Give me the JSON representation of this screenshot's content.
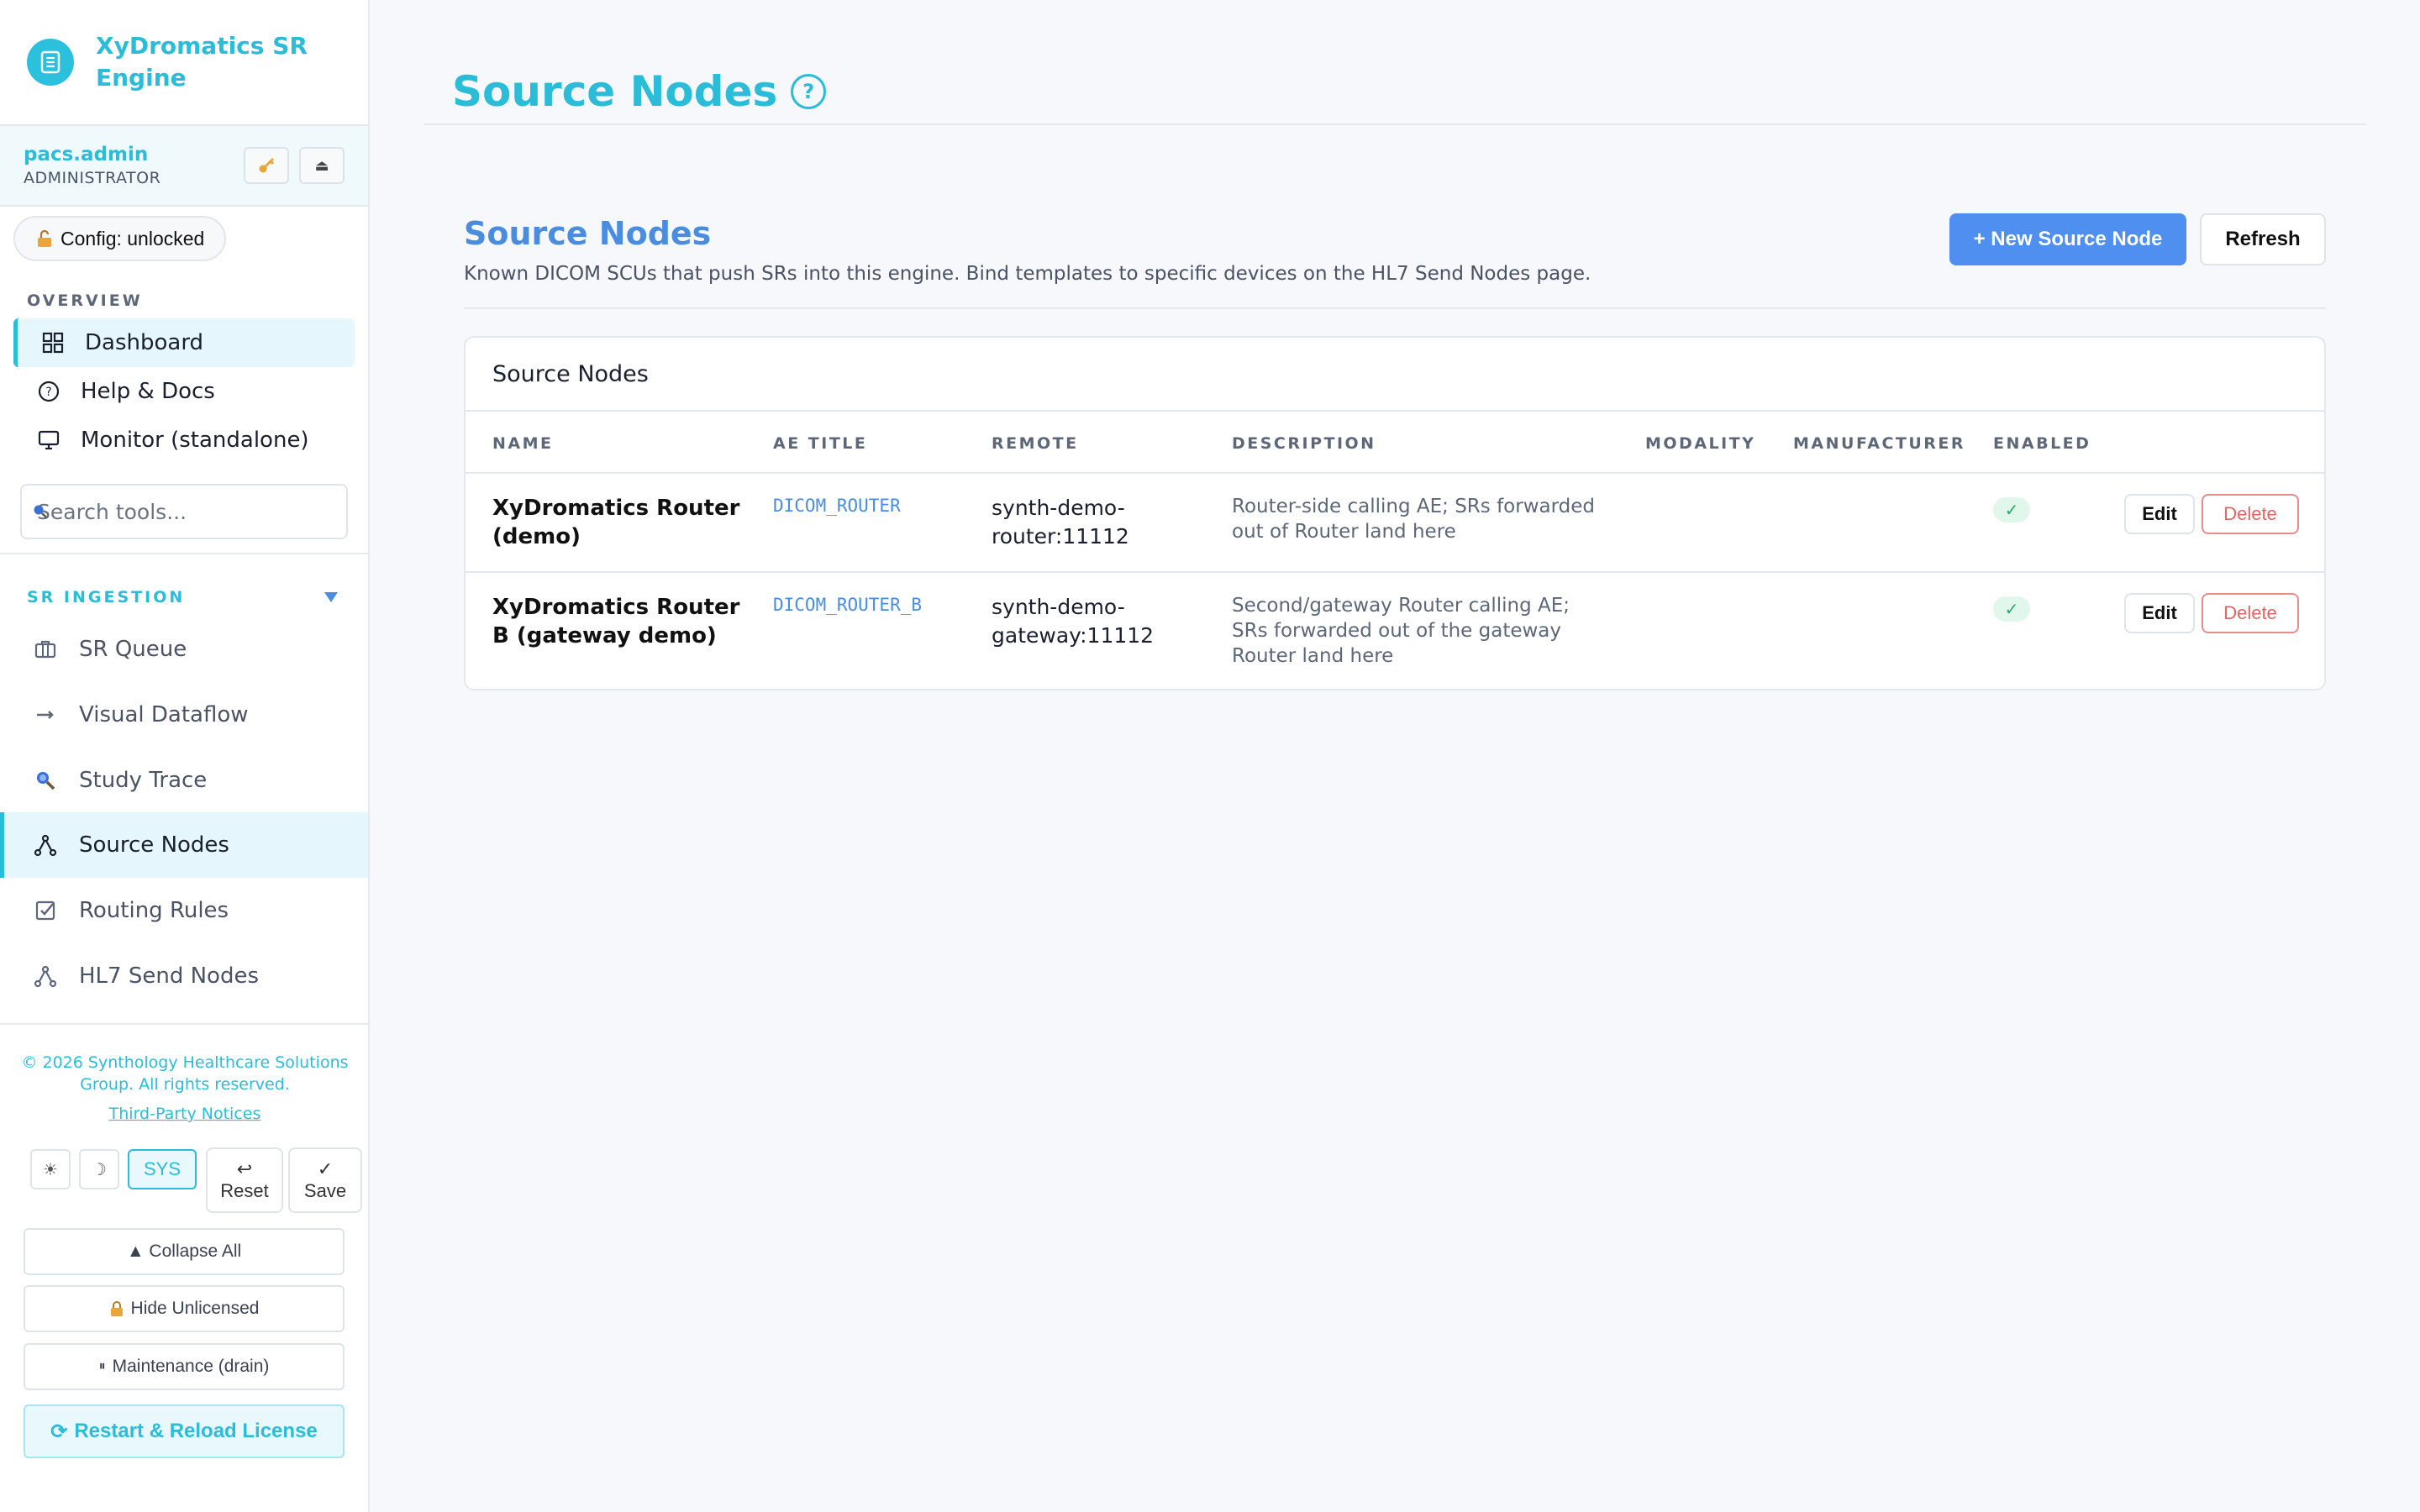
{
  "app": {
    "title": "XyDromatics SR Engine",
    "accent_color": "#2bbcd8",
    "primary_color": "#4e8ff0"
  },
  "user": {
    "name": "pacs.admin",
    "role": "ADMINISTRATOR",
    "key_icon": "key-icon",
    "eject_icon": "eject-icon"
  },
  "config": {
    "label": "Config: unlocked",
    "icon": "unlock-icon"
  },
  "overview": {
    "label": "OVERVIEW",
    "items": [
      {
        "label": "Dashboard",
        "icon": "grid-icon",
        "active": true
      },
      {
        "label": "Help & Docs",
        "icon": "help-icon"
      },
      {
        "label": "Monitor (standalone)",
        "icon": "monitor-icon"
      }
    ]
  },
  "search": {
    "placeholder": "Search tools..."
  },
  "sr_ingestion": {
    "label": "SR INGESTION",
    "items": [
      {
        "label": "SR Queue",
        "icon": "briefcase-icon"
      },
      {
        "label": "Visual Dataflow",
        "icon": "arrow-right-icon"
      },
      {
        "label": "Study Trace",
        "icon": "magnifier-icon"
      },
      {
        "label": "Source Nodes",
        "icon": "nodes-icon",
        "active": true
      },
      {
        "label": "Routing Rules",
        "icon": "checkbox-icon"
      },
      {
        "label": "HL7 Send Nodes",
        "icon": "nodes-icon"
      }
    ]
  },
  "footer": {
    "copyright": "© 2026 Synthology Healthcare Solutions Group. All rights reserved.",
    "notices": "Third-Party Notices",
    "theme_light": "☀",
    "theme_dark": "☽",
    "theme_sys": "SYS",
    "reset_label": "Reset",
    "save_label": "Save",
    "collapse_all": "▲ Collapse All",
    "hide_unlicensed": "Hide Unlicensed",
    "maintenance": "Maintenance (drain)",
    "restart": "Restart & Reload License"
  },
  "page": {
    "title": "Source Nodes",
    "section_title": "Source Nodes",
    "section_desc": "Known DICOM SCUs that push SRs into this engine. Bind templates to specific devices on the HL7 Send Nodes page.",
    "new_button": "+ New Source Node",
    "refresh_button": "Refresh",
    "card_title": "Source Nodes",
    "columns": [
      "NAME",
      "AE TITLE",
      "REMOTE",
      "DESCRIPTION",
      "MODALITY",
      "MANUFACTURER",
      "ENABLED"
    ],
    "rows": [
      {
        "name": "XyDromatics Router (demo)",
        "ae_title": "DICOM_ROUTER",
        "remote": "synth-demo-router:11112",
        "description": "Router-side calling AE; SRs forwarded out of Router land here",
        "modality": "",
        "manufacturer": "",
        "enabled": "✓",
        "edit": "Edit",
        "delete": "Delete"
      },
      {
        "name": "XyDromatics Router B (gateway demo)",
        "ae_title": "DICOM_ROUTER_B",
        "remote": "synth-demo-gateway:11112",
        "description": "Second/gateway Router calling AE; SRs forwarded out of the gateway Router land here",
        "modality": "",
        "manufacturer": "",
        "enabled": "✓",
        "edit": "Edit",
        "delete": "Delete"
      }
    ]
  }
}
